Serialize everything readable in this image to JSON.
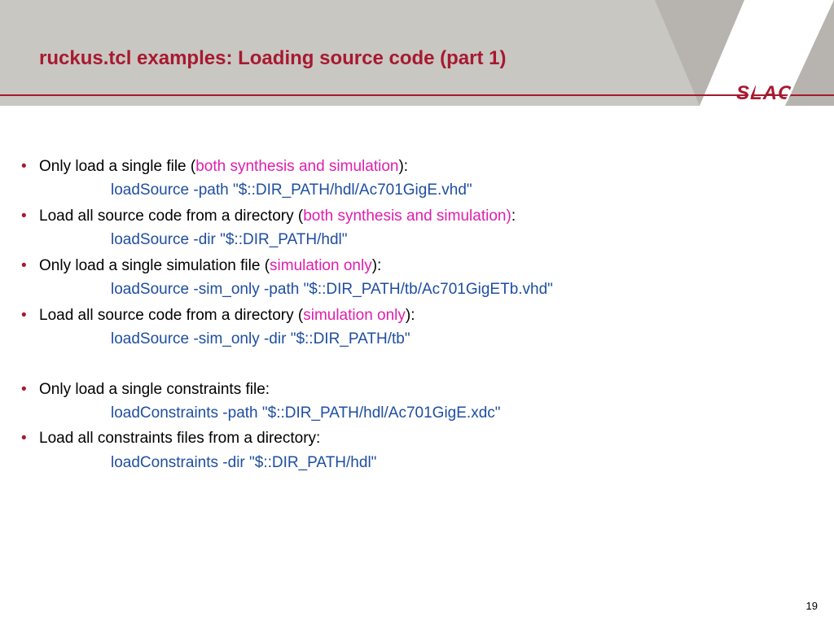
{
  "title": "ruckus.tcl examples: Loading source code (part 1)",
  "logo_text": "SLAC",
  "page_number": "19",
  "items": [
    {
      "pre": "Only load a single file (",
      "em": "both synthesis and simulation",
      "post": "):",
      "code": "loadSource -path \"$::DIR_PATH/hdl/Ac701GigE.vhd\""
    },
    {
      "pre": "Load all source code from a directory (",
      "em": "both synthesis and simulation)",
      "post": ":",
      "code": "loadSource -dir \"$::DIR_PATH/hdl\""
    },
    {
      "pre": "Only load a single simulation file (",
      "em": "simulation only",
      "post": "):",
      "code": "loadSource -sim_only -path \"$::DIR_PATH/tb/Ac701GigETb.vhd\""
    },
    {
      "pre": "Load all source code from a directory (",
      "em": "simulation only",
      "post": "):",
      "code": "loadSource -sim_only -dir \"$::DIR_PATH/tb\""
    },
    {
      "pre": "Only load a single constraints file:",
      "em": "",
      "post": "",
      "code": "loadConstraints -path \"$::DIR_PATH/hdl/Ac701GigE.xdc\""
    },
    {
      "pre": "Load all constraints files from a directory:",
      "em": "",
      "post": "",
      "code": "loadConstraints -dir \"$::DIR_PATH/hdl\""
    }
  ]
}
